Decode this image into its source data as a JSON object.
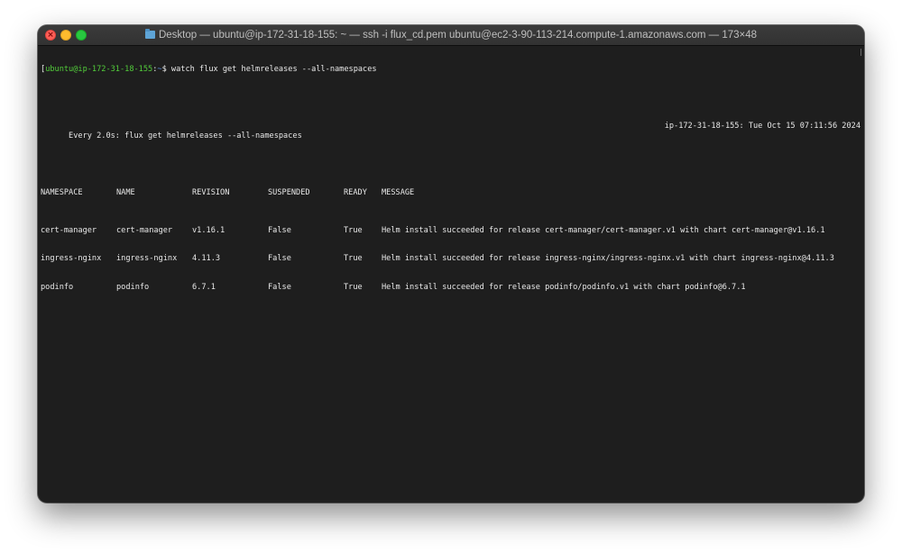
{
  "window": {
    "title": "Desktop — ubuntu@ip-172-31-18-155: ~ — ssh -i flux_cd.pem ubuntu@ec2-3-90-113-214.compute-1.amazonaws.com — 173×48",
    "title_icon": "folder-icon"
  },
  "prompt": {
    "open_bracket": "[",
    "user_host": "ubuntu@ip-172-31-18-155",
    "separator": ":",
    "path": "~",
    "symbol": "$",
    "command": " watch flux get helmreleases --all-namespaces"
  },
  "watch": {
    "left": "Every 2.0s: flux get helmreleases --all-namespaces",
    "right": "ip-172-31-18-155: Tue Oct 15 07:11:56 2024"
  },
  "table": {
    "headers": [
      "NAMESPACE",
      "NAME",
      "REVISION",
      "SUSPENDED",
      "READY",
      "MESSAGE"
    ],
    "rows": [
      [
        "cert-manager",
        "cert-manager",
        "v1.16.1",
        "False",
        "True",
        "Helm install succeeded for release cert-manager/cert-manager.v1 with chart cert-manager@v1.16.1"
      ],
      [
        "ingress-nginx",
        "ingress-nginx",
        "4.11.3",
        "False",
        "True",
        "Helm install succeeded for release ingress-nginx/ingress-nginx.v1 with chart ingress-nginx@4.11.3"
      ],
      [
        "podinfo",
        "podinfo",
        "6.7.1",
        "False",
        "True",
        "Helm install succeeded for release podinfo/podinfo.v1 with chart podinfo@6.7.1"
      ]
    ]
  },
  "colors": {
    "terminal_bg": "#1e1e1e",
    "terminal_fg": "#e8e8e8",
    "prompt_user": "#52cc3a",
    "prompt_path": "#5a8de0"
  }
}
